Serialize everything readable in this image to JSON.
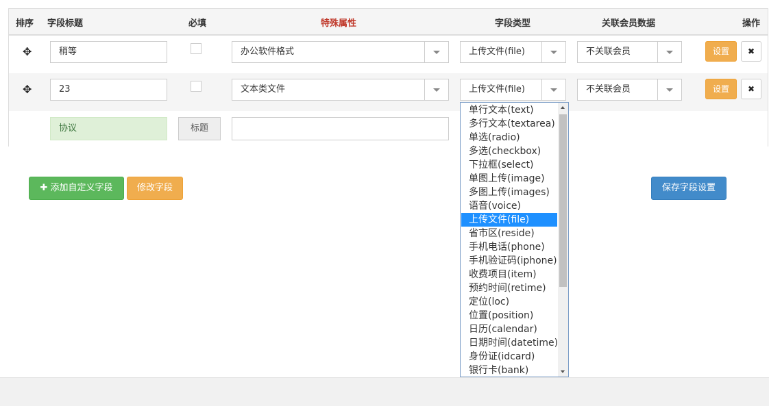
{
  "headers": {
    "sort": "排序",
    "field_title": "字段标题",
    "required": "必填",
    "special": "特殊属性",
    "field_type": "字段类型",
    "member_link": "关联会员数据",
    "ops": "操作"
  },
  "rows": [
    {
      "title": "稍等",
      "required": false,
      "special": "办公软件格式",
      "type": "上传文件(file)",
      "member": "不关联会员",
      "set_label": "设置",
      "delete_label": "✖"
    },
    {
      "title": "23",
      "required": false,
      "special": "文本类文件",
      "type": "上传文件(file)",
      "member": "不关联会员",
      "set_label": "设置",
      "delete_label": "✖"
    }
  ],
  "agreement_row": {
    "agreement_label": "协议",
    "title_tag": "标题",
    "title_value": ""
  },
  "buttons": {
    "add_icon": "✚",
    "add_label": "添加自定义字段",
    "modify_label": "修改字段",
    "save_label": "保存字段设置"
  },
  "type_dropdown": {
    "selected": "上传文件(file)",
    "options": [
      "单行文本(text)",
      "多行文本(textarea)",
      "单选(radio)",
      "多选(checkbox)",
      "下拉框(select)",
      "单图上传(image)",
      "多图上传(images)",
      "语音(voice)",
      "上传文件(file)",
      "省市区(reside)",
      "手机电话(phone)",
      "手机验证码(iphone)",
      "收费项目(item)",
      "预约时间(retime)",
      "定位(loc)",
      "位置(position)",
      "日历(calendar)",
      "日期时间(datetime)",
      "身份证(idcard)",
      "银行卡(bank)"
    ]
  },
  "icons": {
    "move": "move-icon",
    "check": "checkbox",
    "delete": "close-icon"
  }
}
